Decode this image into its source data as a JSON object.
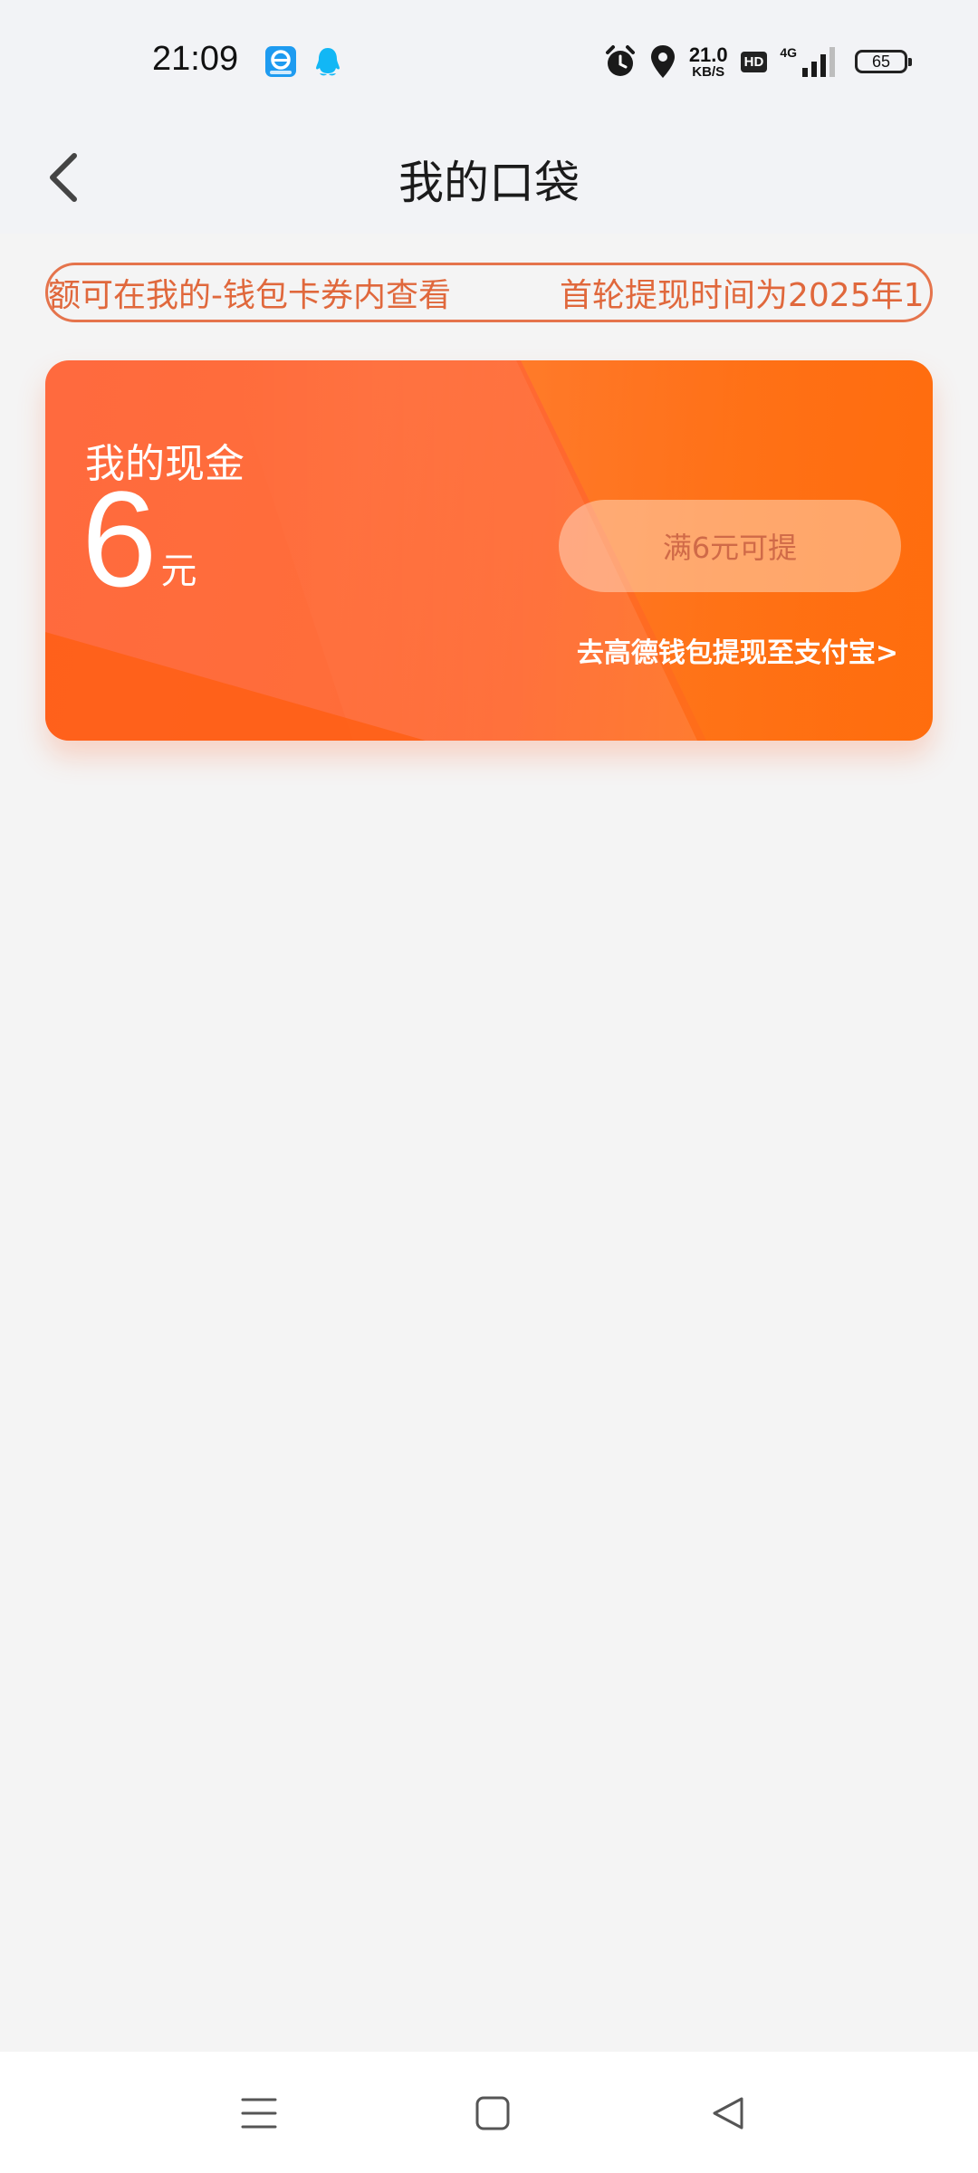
{
  "status_bar": {
    "time": "21:09",
    "icons_left": [
      "eleme-app-icon",
      "qq-app-icon"
    ],
    "icons_right": [
      "alarm-icon",
      "location-icon",
      "hd-icon",
      "signal-4g-icon",
      "battery-icon"
    ],
    "net_speed_value": "21.0",
    "net_speed_unit": "KB/S",
    "hd_label": "HD",
    "network_label": "4G",
    "battery_level": "65"
  },
  "header": {
    "title": "我的口袋",
    "back_icon": "chevron-left-icon"
  },
  "notice": {
    "text_1": "额可在我的-钱包卡券内查看",
    "text_2": "首轮提现时间为2025年1"
  },
  "cash_card": {
    "label": "我的现金",
    "amount": "6",
    "unit": "元",
    "withdraw_button_label": "满6元可提",
    "alipay_link_label": "去高德钱包提现至支付宝>"
  },
  "nav_bar": {
    "icons": [
      "menu-icon",
      "home-icon",
      "back-triangle-icon"
    ]
  },
  "colors": {
    "accent": "#ff6a30",
    "notice": "#e0683c",
    "background": "#f4f4f4"
  }
}
